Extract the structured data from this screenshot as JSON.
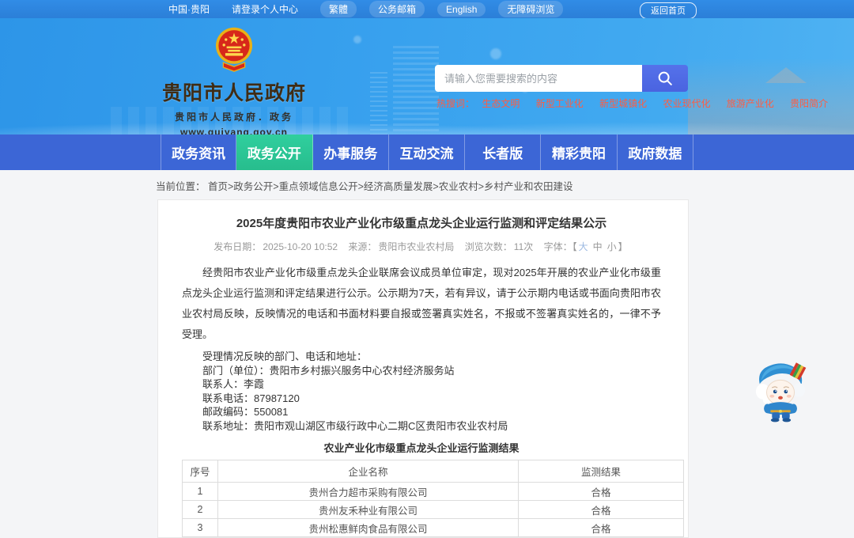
{
  "colors": {
    "topbar_blue": "#2f8ae0",
    "banner_blue": "#38a1ee",
    "nav_blue": "#3c66d6",
    "active_green": "#2bc492",
    "hotword_red": "#ff5c42",
    "search_button_blue": "#4e69e4"
  },
  "topbar": {
    "left_items": [
      "中国·贵阳",
      "请登录个人中心"
    ],
    "pills": [
      "繁體",
      "公务邮箱",
      "English",
      "无障碍浏览"
    ],
    "home_button": "返回首页"
  },
  "header": {
    "site_title": "贵阳市人民政府",
    "site_subtitle": "贵阳市人民政府．政务",
    "site_url": "www.guiyang.gov.cn",
    "search": {
      "placeholder": "请输入您需要搜索的内容"
    },
    "hot": {
      "label": "热搜词：",
      "words": [
        "生态文明",
        "新型工业化",
        "新型城镇化",
        "农业现代化",
        "旅游产业化",
        "贵阳简介"
      ]
    }
  },
  "nav": {
    "items": [
      {
        "label": "政务资讯"
      },
      {
        "label": "政务公开"
      },
      {
        "label": "办事服务"
      },
      {
        "label": "互动交流"
      },
      {
        "label": "长者版"
      },
      {
        "label": "精彩贵阳"
      },
      {
        "label": "政府数据"
      }
    ],
    "active_index": 1
  },
  "breadcrumb": {
    "label": "当前位置：",
    "path": "首页>政务公开>重点领域信息公开>经济高质量发展>农业农村>乡村产业和农田建设"
  },
  "article": {
    "title": "2025年度贵阳市农业产业化市级重点龙头企业运行监测和评定结果公示",
    "meta": {
      "publish_label": "发布日期：",
      "publish_value": "2025-10-20 10:52",
      "source_label": "来源：",
      "source_value": "贵阳市农业农村局",
      "views_label": "浏览次数：",
      "views_value": "11次",
      "font_label": "字体：【",
      "font_large": "大",
      "font_mid": "中",
      "font_small": "小",
      "font_close": "】"
    },
    "paragraph": "经贵阳市农业产业化市级重点龙头企业联席会议成员单位审定，现对2025年开展的农业产业化市级重点龙头企业运行监测和评定结果进行公示。公示期为7天，若有异议，请于公示期内电话或书面向贵阳市农业农村局反映，反映情况的电话和书面材料要自报或签署真实姓名，不报或不签署真实姓名的，一律不予受理。",
    "contact_lines": [
      "受理情况反映的部门、电话和地址：",
      "部门（单位）：贵阳市乡村振兴服务中心农村经济服务站",
      "联系人：李霞",
      "联系电话：87987120",
      "邮政编码：550081",
      "联系地址：贵阳市观山湖区市级行政中心二期C区贵阳市农业农村局"
    ],
    "table_caption": "农业产业化市级重点龙头企业运行监测结果",
    "table": {
      "headers": [
        "序号",
        "企业名称",
        "监测结果"
      ],
      "rows": [
        [
          "1",
          "贵州合力超市采购有限公司",
          "合格"
        ],
        [
          "2",
          "贵州友禾种业有限公司",
          "合格"
        ],
        [
          "3",
          "贵州松惠鲜肉食品有限公司",
          "合格"
        ]
      ]
    }
  }
}
